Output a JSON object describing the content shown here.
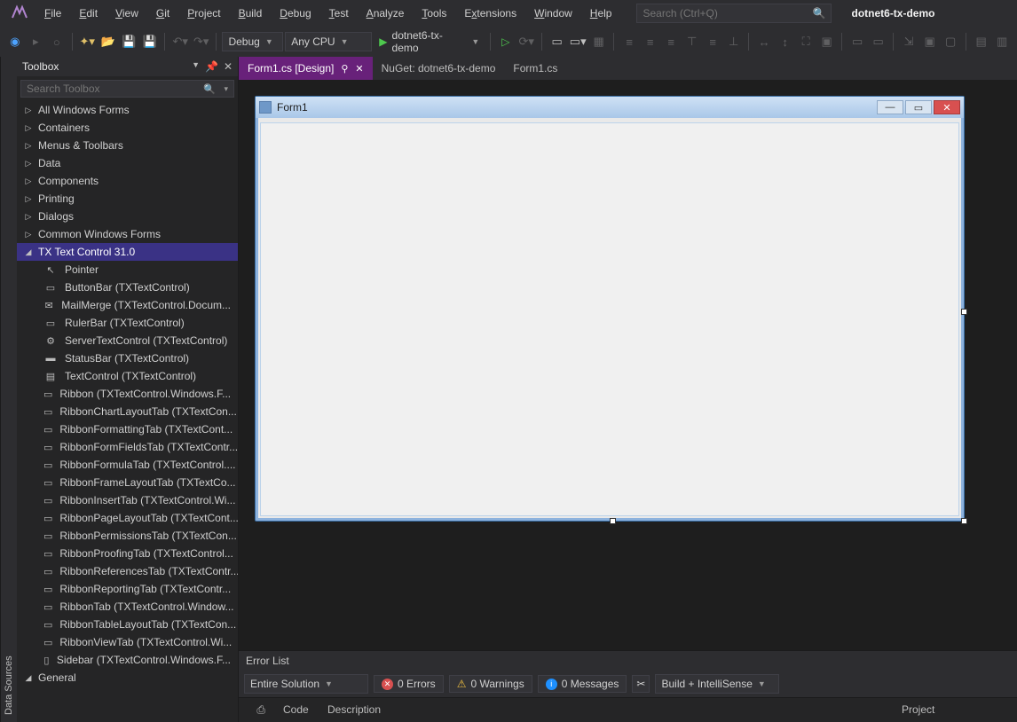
{
  "menubar": {
    "items": [
      "File",
      "Edit",
      "View",
      "Git",
      "Project",
      "Build",
      "Debug",
      "Test",
      "Analyze",
      "Tools",
      "Extensions",
      "Window",
      "Help"
    ],
    "search_placeholder": "Search (Ctrl+Q)",
    "solution_name": "dotnet6-tx-demo"
  },
  "toolbar": {
    "config_label": "Debug",
    "platform_label": "Any CPU",
    "run_target": "dotnet6-tx-demo"
  },
  "side_tab_label": "Data Sources",
  "toolbox": {
    "title": "Toolbox",
    "search_placeholder": "Search Toolbox",
    "groups": [
      {
        "label": "All Windows Forms",
        "expanded": false
      },
      {
        "label": "Containers",
        "expanded": false
      },
      {
        "label": "Menus & Toolbars",
        "expanded": false
      },
      {
        "label": "Data",
        "expanded": false
      },
      {
        "label": "Components",
        "expanded": false
      },
      {
        "label": "Printing",
        "expanded": false
      },
      {
        "label": "Dialogs",
        "expanded": false
      },
      {
        "label": "Common Windows Forms",
        "expanded": false
      }
    ],
    "selected_group": {
      "label": "TX Text Control 31.0",
      "expanded": true
    },
    "selected_items": [
      {
        "icon": "pointer",
        "label": "Pointer"
      },
      {
        "icon": "ruler",
        "label": "ButtonBar (TXTextControl)"
      },
      {
        "icon": "mail",
        "label": "MailMerge (TXTextControl.Docum..."
      },
      {
        "icon": "ruler",
        "label": "RulerBar (TXTextControl)"
      },
      {
        "icon": "gear",
        "label": "ServerTextControl (TXTextControl)"
      },
      {
        "icon": "status",
        "label": "StatusBar (TXTextControl)"
      },
      {
        "icon": "text",
        "label": "TextControl (TXTextControl)"
      },
      {
        "icon": "ribbon",
        "label": "Ribbon (TXTextControl.Windows.F..."
      },
      {
        "icon": "tab",
        "label": "RibbonChartLayoutTab (TXTextCon..."
      },
      {
        "icon": "tab",
        "label": "RibbonFormattingTab (TXTextCont..."
      },
      {
        "icon": "tab",
        "label": "RibbonFormFieldsTab (TXTextContr..."
      },
      {
        "icon": "tab",
        "label": "RibbonFormulaTab (TXTextControl...."
      },
      {
        "icon": "tab",
        "label": "RibbonFrameLayoutTab (TXTextCo..."
      },
      {
        "icon": "tab",
        "label": "RibbonInsertTab (TXTextControl.Wi..."
      },
      {
        "icon": "tab",
        "label": "RibbonPageLayoutTab (TXTextCont..."
      },
      {
        "icon": "tab",
        "label": "RibbonPermissionsTab (TXTextCon..."
      },
      {
        "icon": "tab",
        "label": "RibbonProofingTab (TXTextControl..."
      },
      {
        "icon": "tab",
        "label": "RibbonReferencesTab (TXTextContr..."
      },
      {
        "icon": "tab",
        "label": "RibbonReportingTab (TXTextContr..."
      },
      {
        "icon": "tab",
        "label": "RibbonTab (TXTextControl.Window..."
      },
      {
        "icon": "tab",
        "label": "RibbonTableLayoutTab (TXTextCon..."
      },
      {
        "icon": "tab",
        "label": "RibbonViewTab (TXTextControl.Wi..."
      },
      {
        "icon": "sidebar",
        "label": "Sidebar (TXTextControl.Windows.F..."
      }
    ],
    "trailing_group": {
      "label": "General",
      "expanded": true
    }
  },
  "doc_tabs": [
    {
      "label": "Form1.cs [Design]",
      "active": true,
      "pinned": true
    },
    {
      "label": "NuGet: dotnet6-tx-demo",
      "active": false
    },
    {
      "label": "Form1.cs",
      "active": false
    }
  ],
  "form": {
    "title": "Form1"
  },
  "error_list": {
    "title": "Error List",
    "scope_label": "Entire Solution",
    "errors_label": "0 Errors",
    "warnings_label": "0 Warnings",
    "messages_label": "0 Messages",
    "build_label": "Build + IntelliSense",
    "columns": {
      "code": "Code",
      "description": "Description",
      "project": "Project"
    }
  }
}
